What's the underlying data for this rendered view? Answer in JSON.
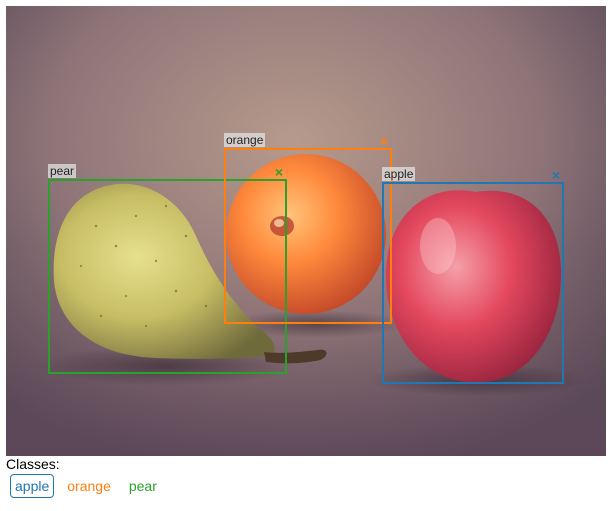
{
  "colors": {
    "apple": "#1f77b4",
    "orange": "#ff7f0e",
    "pear": "#2ca02c"
  },
  "image": {
    "subjects": [
      "pear",
      "orange",
      "apple"
    ]
  },
  "boxes": [
    {
      "label": "pear",
      "color": "#2ca02c",
      "close_icon": "close-icon"
    },
    {
      "label": "orange",
      "color": "#ff7f0e",
      "close_icon": "close-icon"
    },
    {
      "label": "apple",
      "color": "#1f77b4",
      "close_icon": "close-icon"
    }
  ],
  "classes": {
    "title": "Classes:",
    "items": [
      {
        "label": "apple",
        "color": "#1f77b4",
        "selected": true
      },
      {
        "label": "orange",
        "color": "#ff7f0e",
        "selected": false
      },
      {
        "label": "pear",
        "color": "#2ca02c",
        "selected": false
      }
    ]
  }
}
